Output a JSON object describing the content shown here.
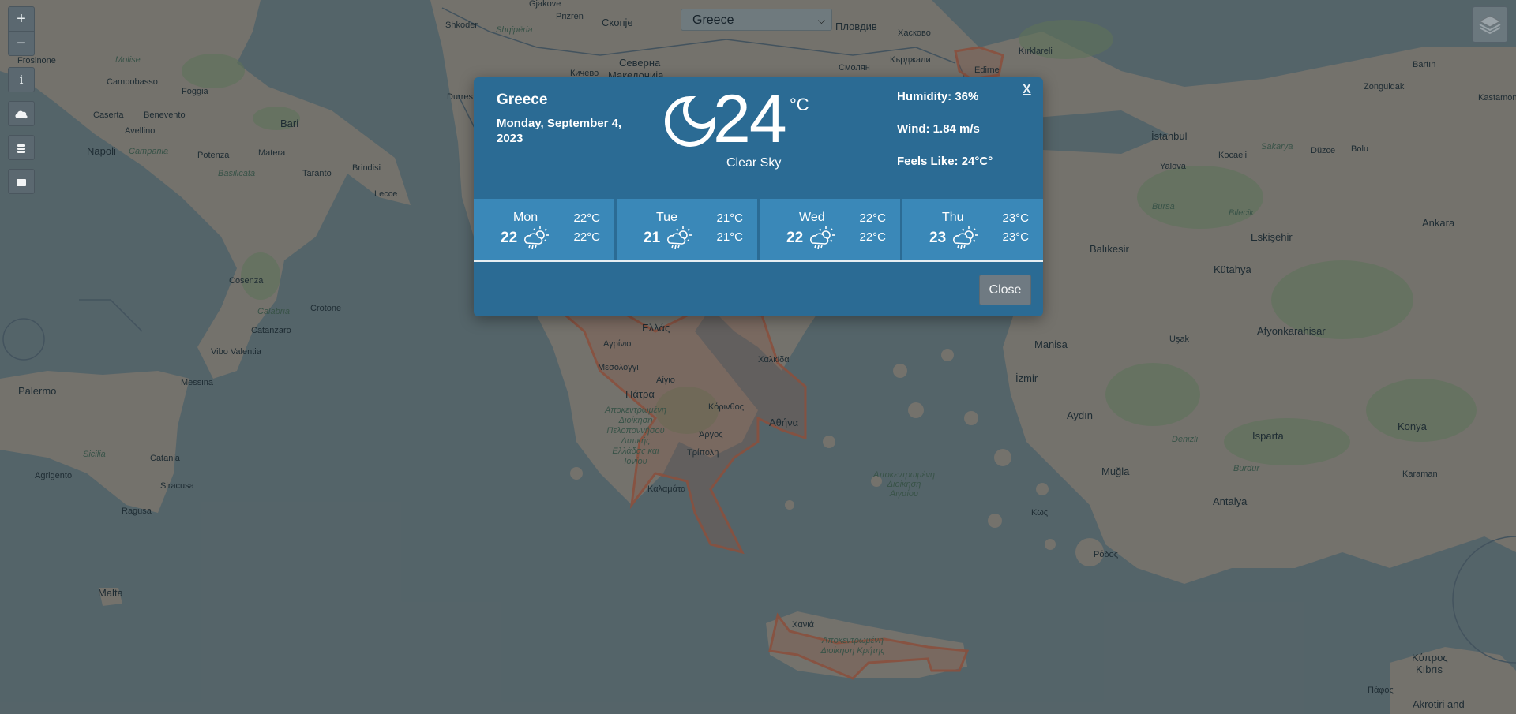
{
  "map": {
    "labels": {
      "frosinone": "Frosinone",
      "campobasso": "Campobasso",
      "foggia": "Foggia",
      "caserta": "Caserta",
      "benevento": "Benevento",
      "avellino": "Avellino",
      "napoli": "Napoli",
      "bari": "Bari",
      "molise": "Molise",
      "campania": "Campania",
      "potenza": "Potenza",
      "matera": "Matera",
      "basilicata": "Basilicata",
      "taranto": "Taranto",
      "brindisi": "Brindisi",
      "lecce": "Lecce",
      "cosenza": "Cosenza",
      "calabria": "Calabria",
      "crotone": "Crotone",
      "catanzaro": "Catanzaro",
      "vibo": "Vibo Valentia",
      "messina": "Messina",
      "palermo": "Palermo",
      "sicilia": "Sicilia",
      "catania": "Catania",
      "agrigento": "Agrigento",
      "siracusa": "Siracusa",
      "ragusa": "Ragusa",
      "malta": "Malta",
      "shkoder": "Shkoder",
      "durres": "Durres",
      "shqiperia": "Shqipëria",
      "prizren": "Prizren",
      "skopje": "Скопје",
      "gjakove": "Gjakove",
      "kichevo": "Кичево",
      "severna": "Северна",
      "makedonija": "Македонија",
      "plovdiv": "Пловдив",
      "haskovo": "Хасково",
      "smolyan": "Смолян",
      "kardzhali": "Кърджали",
      "kirklareli": "Kırklareli",
      "edirne": "Edirne",
      "istanbul": "İstanbul",
      "kocaeli": "Kocaeli",
      "sakarya": "Sakarya",
      "duzce": "Düzce",
      "bolu": "Bolu",
      "zonguldak": "Zonguldak",
      "bartin": "Bartın",
      "kastamonu": "Kastamonu",
      "yalova": "Yalova",
      "bursa": "Bursa",
      "bilecik": "Bilecik",
      "eskisehir": "Eskişehir",
      "ankara": "Ankara",
      "balikesir": "Balıkesir",
      "kutahya": "Kütahya",
      "manisa": "Manisa",
      "izmir": "İzmir",
      "usak": "Uşak",
      "afyon": "Afyonkarahisar",
      "aydin": "Aydın",
      "denizli": "Denizli",
      "isparta": "Isparta",
      "konya": "Konya",
      "mugla": "Muğla",
      "burdur": "Burdur",
      "antalya": "Antalya",
      "karaman": "Karaman",
      "kos": "Κως",
      "rodos": "Ρόδος",
      "ellas": "Ελλάς",
      "agrinio": "Αγρίνιο",
      "mesologgi": "Μεσολογγι",
      "patra": "Πάτρα",
      "aigio": "Αίγιο",
      "korinthos": "Κόρινθος",
      "athina": "Αθήνα",
      "argos": "Άργος",
      "tripoli": "Τρίπολη",
      "kalamata": "Καλαμάτα",
      "chalkida": "Χαλκίδα",
      "aigaio": "Αποκεντρωμένη Διοίκηση Αιγαίου",
      "pelop": "Αποκεντρωμένη Διοίκηση Πελοποννήσου Δυτικής Ελλάδας και Ιονίου",
      "chania": "Χανιά",
      "kriti": "Αποκεντρωμένη Διοίκηση Κρήτης",
      "kypros": "Κύπρος",
      "kibris": "Kıbrıs",
      "pafos": "Πάφος",
      "akrotiri": "Akrotiri and"
    }
  },
  "controls": {
    "zoom_in": "+",
    "zoom_out": "−",
    "info": "i"
  },
  "country_select": {
    "value": "Greece"
  },
  "weather": {
    "country": "Greece",
    "date": "Monday, September 4, 2023",
    "temp": "24",
    "unit": "°C",
    "condition": "Clear Sky",
    "humidity": "Humidity: 36%",
    "wind": "Wind: 1.84 m/s",
    "feels_like": "Feels Like: 24°C°",
    "close_x": "X",
    "close_label": "Close",
    "forecast": [
      {
        "day": "Mon",
        "temp": "22",
        "hi": "22°C",
        "lo": "22°C",
        "icon": "rain-sun-icon"
      },
      {
        "day": "Tue",
        "temp": "21",
        "hi": "21°C",
        "lo": "21°C",
        "icon": "rain-sun-icon"
      },
      {
        "day": "Wed",
        "temp": "22",
        "hi": "22°C",
        "lo": "22°C",
        "icon": "rain-sun-icon"
      },
      {
        "day": "Thu",
        "temp": "23",
        "hi": "23°C",
        "lo": "23°C",
        "icon": "rain-sun-icon"
      }
    ]
  },
  "colors": {
    "sea": "#5f6e72",
    "land": "#857f76",
    "modal": "#2b6b94",
    "forecast_tile": "#3a88b8",
    "region_outline": "#a0563e"
  }
}
